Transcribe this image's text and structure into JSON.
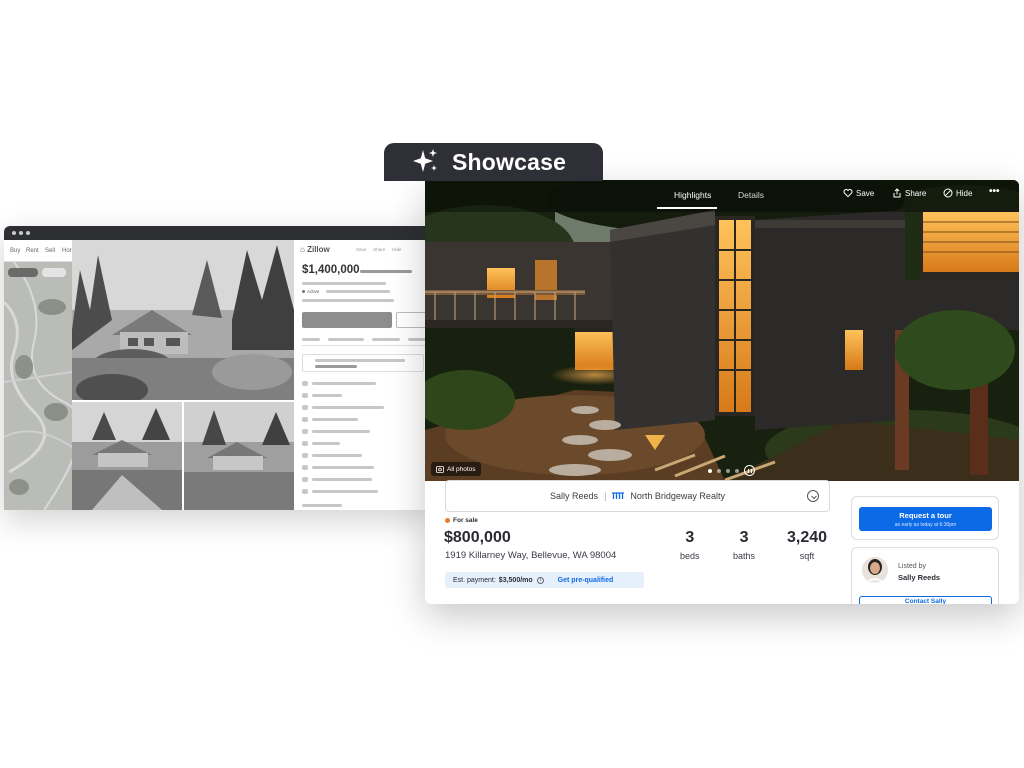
{
  "badge": {
    "label": "Showcase",
    "icon": "sparkle-icon"
  },
  "front": {
    "tabs": [
      {
        "label": "Highlights",
        "active": true
      },
      {
        "label": "Details",
        "active": false
      }
    ],
    "actions": [
      {
        "label": "Save",
        "icon": "heart-icon"
      },
      {
        "label": "Share",
        "icon": "share-icon"
      },
      {
        "label": "Hide",
        "icon": "hide-icon"
      }
    ],
    "more_icon": "more-icon",
    "all_photos_label": "All photos",
    "carousel": {
      "slides_shown": 4,
      "active_index": 0
    },
    "agent": {
      "name": "Sally Reeds",
      "separator": "|",
      "brokerage": "North Bridgeway Realty"
    },
    "status": "For sale",
    "price": "$800,000",
    "address": "1919 Killarney Way, Bellevue, WA 98004",
    "facts": [
      {
        "value": "3",
        "label": "beds"
      },
      {
        "value": "3",
        "label": "baths"
      },
      {
        "value": "3,240",
        "label": "sqft"
      }
    ],
    "payment": {
      "label": "Est. payment:",
      "value": "$3,500/mo",
      "cta": "Get pre-qualified"
    },
    "tour": {
      "label": "Request a tour",
      "sub": "as early as today at 6:30pm"
    },
    "lister": {
      "caption": "Listed by",
      "name": "Sally Reeds",
      "contact": "Contact Sally"
    }
  },
  "back": {
    "nav": [
      "Buy",
      "Rent",
      "Sell",
      "Hor"
    ],
    "logo": "Zillow",
    "header_actions": [
      "Save",
      "Share",
      "Hide"
    ],
    "price": "$1,400,000",
    "status": "Active"
  },
  "colors": {
    "accent": "#0d6ae6",
    "badge_bg": "#2f3037",
    "status_dot": "#e8792b",
    "payment_bg": "#e5f0fc"
  }
}
